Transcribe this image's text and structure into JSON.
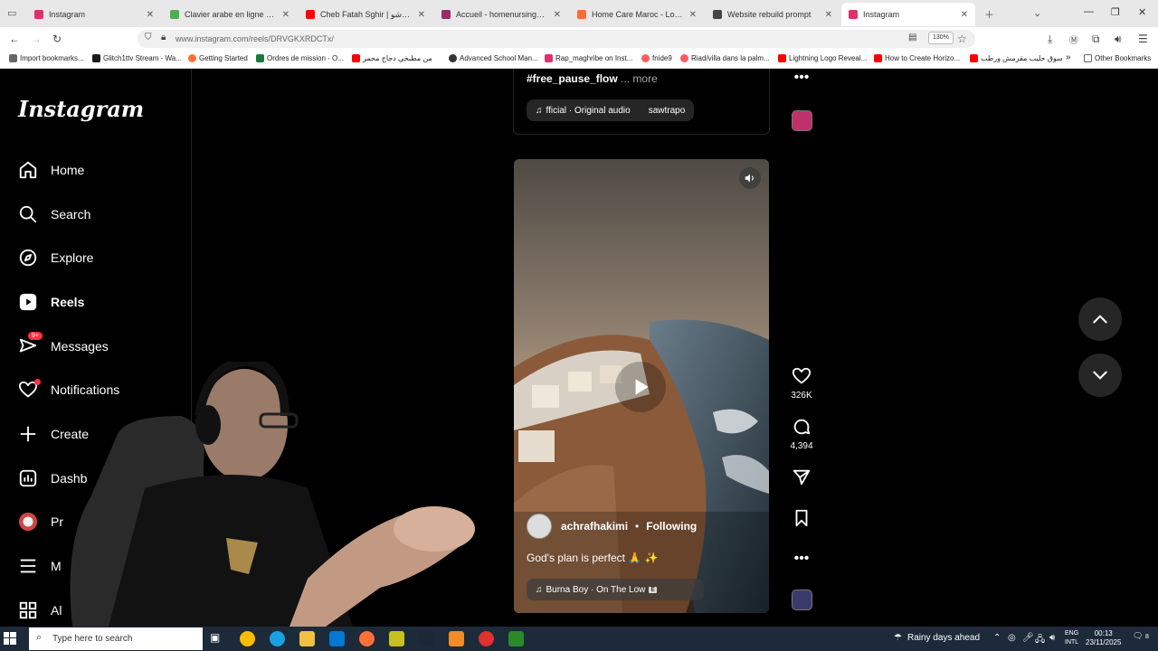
{
  "browser": {
    "tabs": [
      {
        "label": "Instagram",
        "color": "#e1306c"
      },
      {
        "label": "Clavier arabe en ligne - Lexilogo",
        "color": "#4caf50"
      },
      {
        "label": "Cheb Fatah Sghir | شابة شوشو",
        "color": "#ff0000"
      },
      {
        "label": "Accueil - homenursingmaroc",
        "color": "#9c2a6a"
      },
      {
        "label": "Home Care Maroc - Lovable",
        "color": "#ff6b35"
      },
      {
        "label": "Website rebuild prompt",
        "color": "#444444"
      },
      {
        "label": "Instagram",
        "color": "#e1306c"
      }
    ],
    "url": "www.instagram.com/reels/DRVGKXRDCTx/",
    "zoom": "130%",
    "bookmarks": [
      {
        "label": "Import bookmarks...",
        "color": "#666666"
      },
      {
        "label": "Glitch1ttv Stream - Wa...",
        "color": "#1a1a1a"
      },
      {
        "label": "Getting Started",
        "color": "#ff7139"
      },
      {
        "label": "Ordres de mission - O...",
        "color": "#1b7a3a"
      },
      {
        "label": "من مطبخي دجاج محمر",
        "color": "#ff0000"
      },
      {
        "label": "Advanced School Man...",
        "color": "#333333"
      },
      {
        "label": "Rap_maghribe on Inst...",
        "color": "#e1306c"
      },
      {
        "label": "fnide9",
        "color": "#ff5a5f"
      },
      {
        "label": "Riad/villa dans la palm...",
        "color": "#ff5a5f"
      },
      {
        "label": "Lightning Logo Reveal...",
        "color": "#ff0000"
      },
      {
        "label": "How to Create Horizo...",
        "color": "#ff0000"
      },
      {
        "label": "سوق حليب مقرمش ورطب",
        "color": "#ff0000"
      },
      {
        "label": "Other Bookmarks",
        "color": "#666666"
      }
    ]
  },
  "sidebar": {
    "logo": "Instagram",
    "items": [
      {
        "label": "Home"
      },
      {
        "label": "Search"
      },
      {
        "label": "Explore"
      },
      {
        "label": "Reels"
      },
      {
        "label": "Messages"
      },
      {
        "label": "Notifications"
      },
      {
        "label": "Create"
      },
      {
        "label": "Dashb"
      },
      {
        "label": "Pr"
      },
      {
        "label": "M"
      },
      {
        "label": "Al"
      }
    ],
    "messages_badge": "9+"
  },
  "previous_reel": {
    "hashtag": "#free_pause_flow",
    "more": "... more",
    "audio": "fficial · Original audio",
    "audio_user": "sawtrapo"
  },
  "reel": {
    "username": "achrafhakimi",
    "separator": "•",
    "follow_state": "Following",
    "caption": "God's plan is perfect 🙏 ✨",
    "audio": "Burna Boy · On The Low",
    "explicit": "E",
    "likes": "326K",
    "comments": "4,394"
  },
  "taskbar": {
    "search_placeholder": "Type here to search",
    "weather": "Rainy days ahead",
    "lang_1": "ENG",
    "lang_2": "INTL",
    "time": "00:13",
    "date": "23/11/2025",
    "notif_count": "8"
  }
}
